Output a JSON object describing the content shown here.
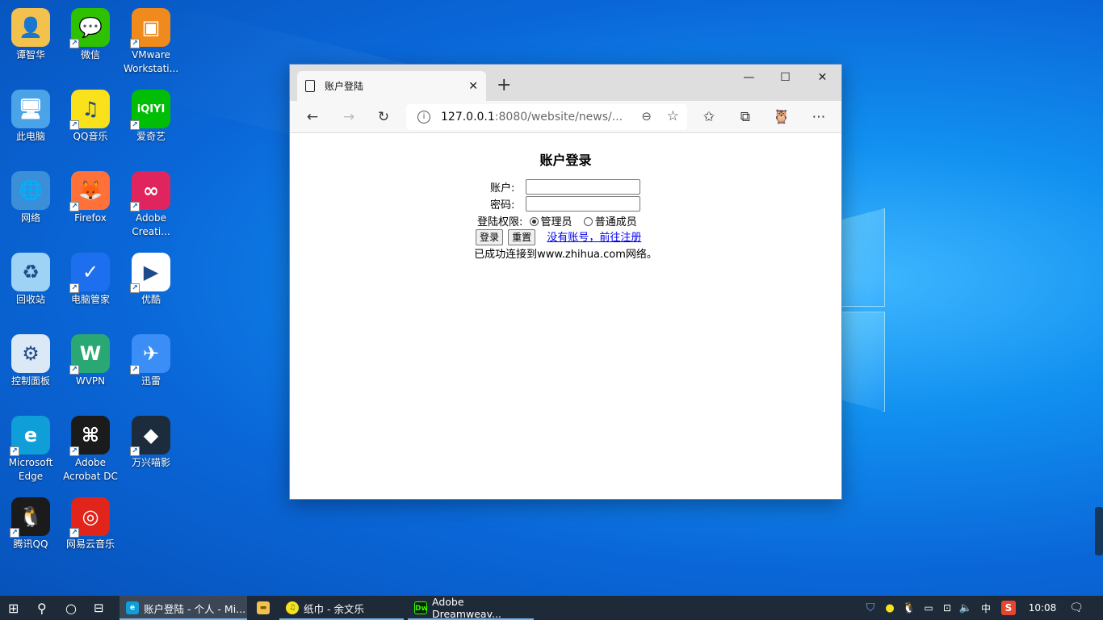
{
  "desktop": {
    "icons": [
      {
        "label": "谭智华",
        "icon": "user-folder-icon",
        "color": "#f2c14e",
        "glyph": "👤"
      },
      {
        "label": "微信",
        "icon": "wechat-icon",
        "color": "#2dc100",
        "glyph": "💬"
      },
      {
        "label": "VMware Workstati...",
        "icon": "vmware-icon",
        "color": "#f08a1c",
        "glyph": "▣"
      },
      {
        "label": "此电脑",
        "icon": "computer-icon",
        "color": "#4aa3e6",
        "glyph": "🖥"
      },
      {
        "label": "QQ音乐",
        "icon": "qq-music-icon",
        "color": "#f9e21b",
        "glyph": "♫"
      },
      {
        "label": "爱奇艺",
        "icon": "iqiyi-icon",
        "color": "#00be06",
        "glyph": "iQIYI"
      },
      {
        "label": "网络",
        "icon": "network-icon",
        "color": "#3a8fd8",
        "glyph": "🌐"
      },
      {
        "label": "Firefox",
        "icon": "firefox-icon",
        "color": "#ff7139",
        "glyph": "🦊"
      },
      {
        "label": "Adobe Creati...",
        "icon": "adobe-cc-icon",
        "color": "#e0245e",
        "glyph": "∞"
      },
      {
        "label": "回收站",
        "icon": "recycle-bin-icon",
        "color": "#9fd3f5",
        "glyph": "♻"
      },
      {
        "label": "电脑管家",
        "icon": "pc-manager-icon",
        "color": "#1e6ff0",
        "glyph": "✓"
      },
      {
        "label": "优酷",
        "icon": "youku-icon",
        "color": "#ffffff",
        "glyph": "▶"
      },
      {
        "label": "控制面板",
        "icon": "control-panel-icon",
        "color": "#dbe8f5",
        "glyph": "⚙"
      },
      {
        "label": "WVPN",
        "icon": "wvpn-icon",
        "color": "#2aa874",
        "glyph": "W"
      },
      {
        "label": "迅雷",
        "icon": "xunlei-icon",
        "color": "#3a8ef6",
        "glyph": "✈"
      },
      {
        "label": "Microsoft Edge",
        "icon": "edge-icon",
        "color": "#0f9ed8",
        "glyph": "e"
      },
      {
        "label": "Adobe Acrobat DC",
        "icon": "acrobat-icon",
        "color": "#1b1b1b",
        "glyph": "⌘"
      },
      {
        "label": "万兴喵影",
        "icon": "filmora-icon",
        "color": "#1d2c3c",
        "glyph": "◆"
      },
      {
        "label": "腾讯QQ",
        "icon": "qq-icon",
        "color": "#1b1b1b",
        "glyph": "🐧"
      },
      {
        "label": "网易云音乐",
        "icon": "netease-music-icon",
        "color": "#e1251b",
        "glyph": "◎"
      }
    ]
  },
  "browser": {
    "tab_title": "账户登陆",
    "tab_close": "✕",
    "new_tab": "+",
    "minimize": "—",
    "maximize": "☐",
    "close": "✕",
    "address_host": "127.0.0.1",
    "address_path": ":8080/website/news/...",
    "info": "i",
    "zoom_glyph": "⊖",
    "fav_glyph": "☆"
  },
  "page": {
    "title": "账户登录",
    "account_label": "账户:",
    "password_label": "密码:",
    "role_label": "登陆权限:",
    "role_admin": "管理员",
    "role_member": "普通成员",
    "login_button": "登录",
    "reset_button": "重置",
    "register_link": "没有账号，前往注册",
    "status_text": "已成功连接到www.zhihua.com网络。"
  },
  "taskbar": {
    "apps": [
      {
        "label": "账户登陆 - 个人 - Mi...",
        "icon": "edge-icon",
        "active": true
      },
      {
        "label": "",
        "icon": "file-explorer-icon",
        "active": false
      },
      {
        "label": "纸巾 - 余文乐",
        "icon": "qq-music-icon",
        "active": false
      },
      {
        "label": "Adobe Dreamweav...",
        "icon": "dreamweaver-icon",
        "active": false
      }
    ],
    "ime": "中",
    "sogou": "S",
    "clock": "10:08"
  }
}
